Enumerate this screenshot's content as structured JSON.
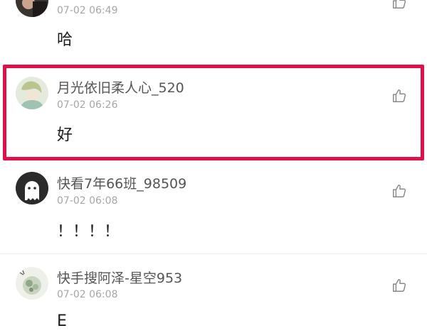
{
  "comments": [
    {
      "username": "",
      "time": "07-02 06:49",
      "text": "哈",
      "avatar": "dark-photo-avatar"
    },
    {
      "username": "月光依旧柔人心_520",
      "time": "07-02 06:26",
      "text": "好",
      "avatar": "anime-boy-avatar"
    },
    {
      "username": "快看7年66班_98509",
      "time": "07-02 06:08",
      "text": "！！！！",
      "avatar": "default-ghost-avatar"
    },
    {
      "username": "快手搜阿泽-星空953",
      "time": "07-02 06:08",
      "text": "E",
      "avatar": "floral-avatar"
    }
  ],
  "icons": {
    "like": "thumbs-up-icon"
  },
  "colors": {
    "highlight": "#e0114a",
    "time": "#a6a6a6",
    "username": "#555555"
  }
}
